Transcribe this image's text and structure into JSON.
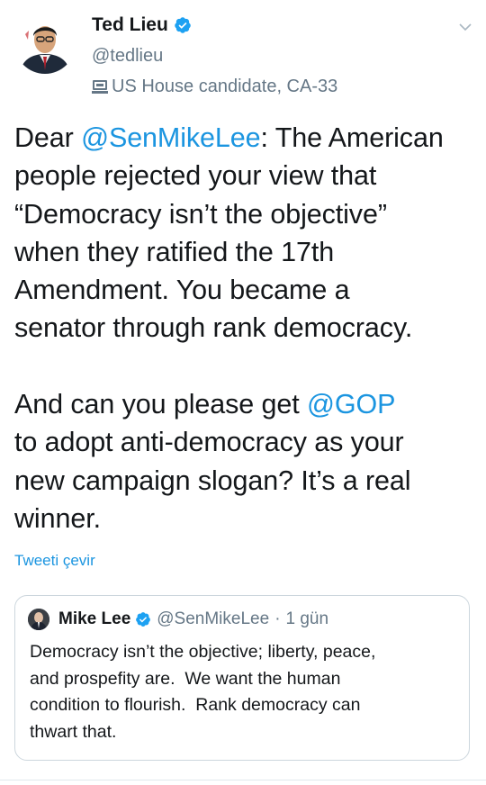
{
  "author": {
    "name": "Ted Lieu",
    "handle": "@tedlieu",
    "label": "US House candidate, CA-33"
  },
  "tweet": {
    "segments": [
      {
        "text": "Dear ",
        "type": "text"
      },
      {
        "text": "@SenMikeLee",
        "type": "mention"
      },
      {
        "text": ": The American\npeople rejected your view that\n“Democracy isn’t the objective”\nwhen they ratified the 17th\nAmendment. You became a\nsenator through rank democracy.\n\nAnd can you please get ",
        "type": "text"
      },
      {
        "text": "@GOP",
        "type": "mention"
      },
      {
        "text": "\nto adopt anti-democracy as your\nnew campaign slogan? It’s a real\nwinner.",
        "type": "text"
      }
    ],
    "translate_label": "Tweeti çevir"
  },
  "quoted": {
    "name": "Mike Lee",
    "handle": "@SenMikeLee",
    "separator": "·",
    "time": "1 gün",
    "text": "Democracy isn’t the objective; liberty, peace,\nand prospefity are.  We want the human\ncondition to flourish.  Rank democracy can\nthwart that."
  },
  "colors": {
    "link": "#1b95e0",
    "verified": "#1da1f2",
    "secondary_text": "#657786"
  },
  "icons": {
    "verified": "verified-badge-icon",
    "menu": "chevron-down-icon",
    "label": "government-building-icon"
  }
}
